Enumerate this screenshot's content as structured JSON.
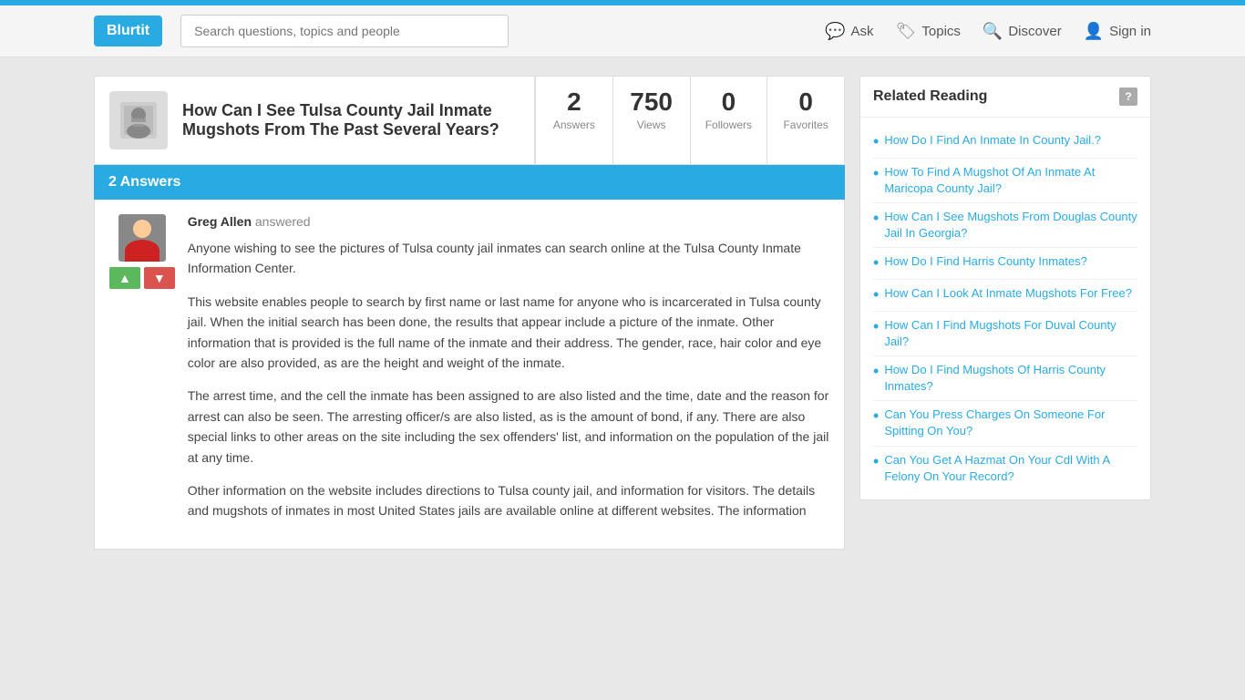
{
  "topBar": {},
  "header": {
    "logo": "Blurtit",
    "search": {
      "placeholder": "Search questions, topics and people"
    },
    "nav": [
      {
        "id": "ask",
        "label": "Ask",
        "icon": "💬"
      },
      {
        "id": "topics",
        "label": "Topics",
        "icon": "🏷"
      },
      {
        "id": "discover",
        "label": "Discover",
        "icon": "🔍"
      },
      {
        "id": "signin",
        "label": "Sign in",
        "icon": "👤"
      }
    ]
  },
  "question": {
    "title": "How Can I See Tulsa County Jail Inmate Mugshots From The Past Several Years?",
    "stats": {
      "answers": {
        "value": "2",
        "label": "Answers"
      },
      "views": {
        "value": "750",
        "label": "Views"
      },
      "followers": {
        "value": "0",
        "label": "Followers"
      },
      "favorites": {
        "value": "0",
        "label": "Favorites"
      }
    }
  },
  "answers": {
    "header": "2 Answers",
    "list": [
      {
        "author": "Greg Allen",
        "action": "answered",
        "paragraphs": [
          "Anyone wishing to see the pictures of Tulsa county jail inmates can search online at the Tulsa County Inmate Information Center.",
          "This website enables people to search by first name or last name for anyone who is incarcerated in Tulsa county jail. When the initial search has been done, the results that appear include a picture of the inmate. Other information that is provided is the full name of the inmate and their address. The gender, race, hair color and eye color are also provided, as are the height and weight of the inmate.",
          "The arrest time, and the cell the inmate has been assigned to are also listed and the time, date and the reason for arrest can also be seen. The arresting officer/s are also listed, as is the amount of bond, if any. There are also special links to other areas on the site including the sex offenders' list, and information on the population of the jail at any time.",
          "Other information on the website includes directions to Tulsa county jail, and information for visitors. The details and mugshots of inmates in most United States jails are available online at different websites. The information"
        ]
      }
    ]
  },
  "sidebar": {
    "title": "Related Reading",
    "helpIcon": "?",
    "links": [
      "How Do I Find An Inmate In County Jail.?",
      "How To Find A Mugshot Of An Inmate At Maricopa County Jail?",
      "How Can I See Mugshots From Douglas County Jail In Georgia?",
      "How Do I Find Harris County Inmates?",
      "How Can I Look At Inmate Mugshots For Free?",
      "How Can I Find Mugshots For Duval County Jail?",
      "How Do I Find Mugshots Of Harris County Inmates?",
      "Can You Press Charges On Someone For Spitting On You?",
      "Can You Get A Hazmat On Your Cdl With A Felony On Your Record?"
    ]
  },
  "votes": {
    "upLabel": "▲",
    "downLabel": "▼"
  }
}
